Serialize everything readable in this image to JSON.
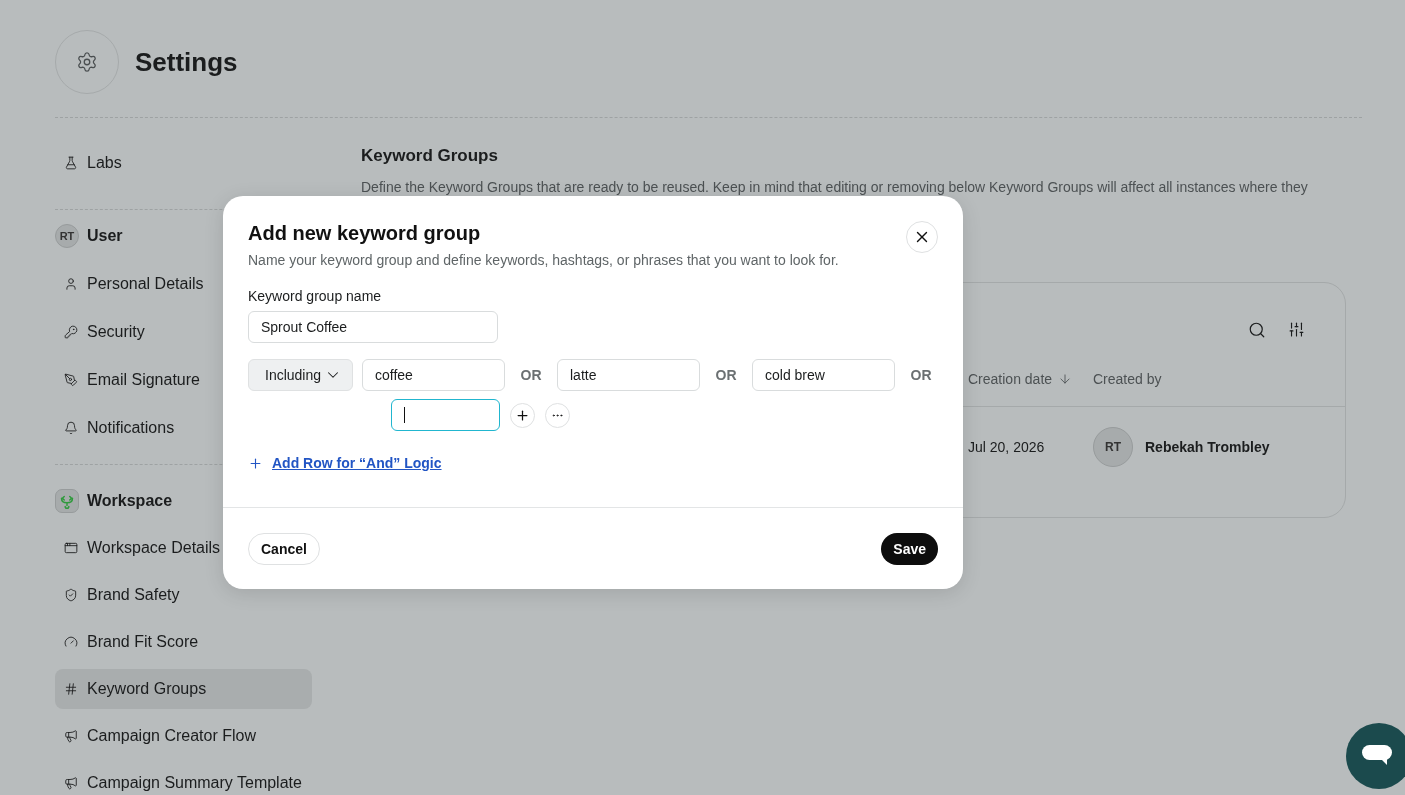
{
  "header": {
    "title": "Settings"
  },
  "sidebar": {
    "sections": [
      {
        "kind": "plain",
        "items": [
          {
            "label": "Labs",
            "selected": false
          }
        ]
      },
      {
        "kind": "user",
        "title": "User",
        "avatar": "RT",
        "items": [
          {
            "label": "Personal Details",
            "selected": false
          },
          {
            "label": "Security",
            "selected": false
          },
          {
            "label": "Email Signature",
            "selected": false
          },
          {
            "label": "Notifications",
            "selected": false
          }
        ]
      },
      {
        "kind": "workspace",
        "title": "Workspace",
        "items": [
          {
            "label": "Workspace Details",
            "selected": false
          },
          {
            "label": "Brand Safety",
            "selected": false
          },
          {
            "label": "Brand Fit Score",
            "selected": false
          },
          {
            "label": "Keyword Groups",
            "selected": true
          },
          {
            "label": "Campaign Creator Flow",
            "selected": false
          },
          {
            "label": "Campaign Summary Template",
            "selected": false
          }
        ]
      }
    ]
  },
  "content": {
    "title": "Keyword Groups",
    "description": "Define the Keyword Groups that are ready to be reused. Keep in mind that editing or removing below Keyword Groups will affect all instances where they"
  },
  "table": {
    "columns": [
      {
        "label": "Creation date",
        "sorted_descending": true
      },
      {
        "label": "Created by",
        "sorted_descending": false
      }
    ],
    "rows": [
      {
        "creation_date": "Jul 20, 2026",
        "created_by": {
          "initials": "RT",
          "name": "Rebekah Trombley"
        }
      }
    ]
  },
  "dialog": {
    "title": "Add new keyword group",
    "subtitle": "Name your keyword group and define keywords, hashtags, or phrases that you want to look for.",
    "name_field": {
      "label": "Keyword group name",
      "value": "Sprout Coffee"
    },
    "rules": [
      {
        "operator": "Including",
        "keywords": [
          {
            "value": "coffee",
            "connector": "OR"
          },
          {
            "value": "latte",
            "connector": "OR"
          },
          {
            "value": "cold brew",
            "connector": "OR"
          }
        ],
        "new_keyword": {
          "focused": true
        }
      }
    ],
    "add_row_link": "Add Row for “And” Logic",
    "cancel": "Cancel",
    "save": "Save"
  }
}
